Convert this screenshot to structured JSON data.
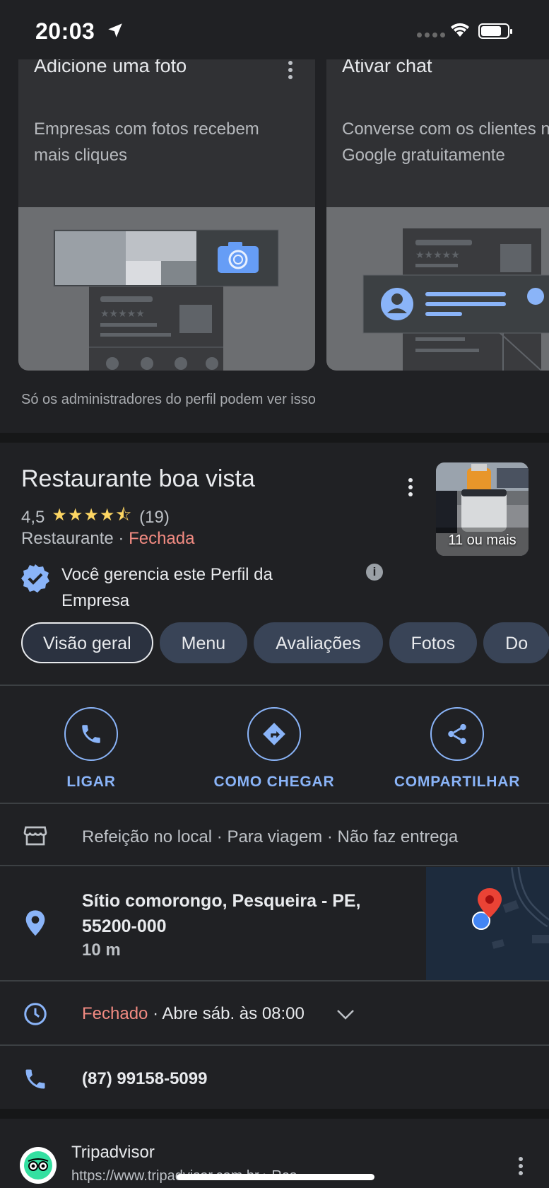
{
  "status_bar": {
    "time": "20:03"
  },
  "promo": {
    "cards": [
      {
        "title": "Adicione uma foto",
        "description": "Empresas com fotos recebem mais cliques"
      },
      {
        "title": "Ativar chat",
        "description": "Converse com os clientes no Google gratuitamente"
      }
    ],
    "admin_note": "Só os administradores do perfil podem ver isso"
  },
  "place": {
    "name": "Restaurante boa vista",
    "rating": "4,5",
    "stars": "★★★★⯪",
    "review_count": "(19)",
    "category": "Restaurante",
    "separator": " · ",
    "status": "Fechada",
    "photo_count": "11 ou mais",
    "verified_text": "Você gerencia este Perfil da Empresa"
  },
  "tabs": [
    "Visão geral",
    "Menu",
    "Avaliações",
    "Fotos",
    "Do"
  ],
  "actions": {
    "call": "LIGAR",
    "directions": "COMO CHEGAR",
    "share": "COMPARTILHAR"
  },
  "info": {
    "dining": "Refeição no local · Para viagem · Não faz entrega",
    "address": "Sítio comorongo, Pesqueira - PE, 55200-000",
    "distance": "10 m",
    "hours_status": "Fechado",
    "hours_detail": " · Abre sáb. às 08:00",
    "phone": "(87) 99158-5099"
  },
  "web_result": {
    "site_name": "Tripadvisor",
    "url": "https://www.tripadvisor.com.br › Res..."
  },
  "colors": {
    "accent": "#8ab4f8",
    "closed": "#f28b82",
    "star": "#fdd663",
    "background": "#202124"
  }
}
